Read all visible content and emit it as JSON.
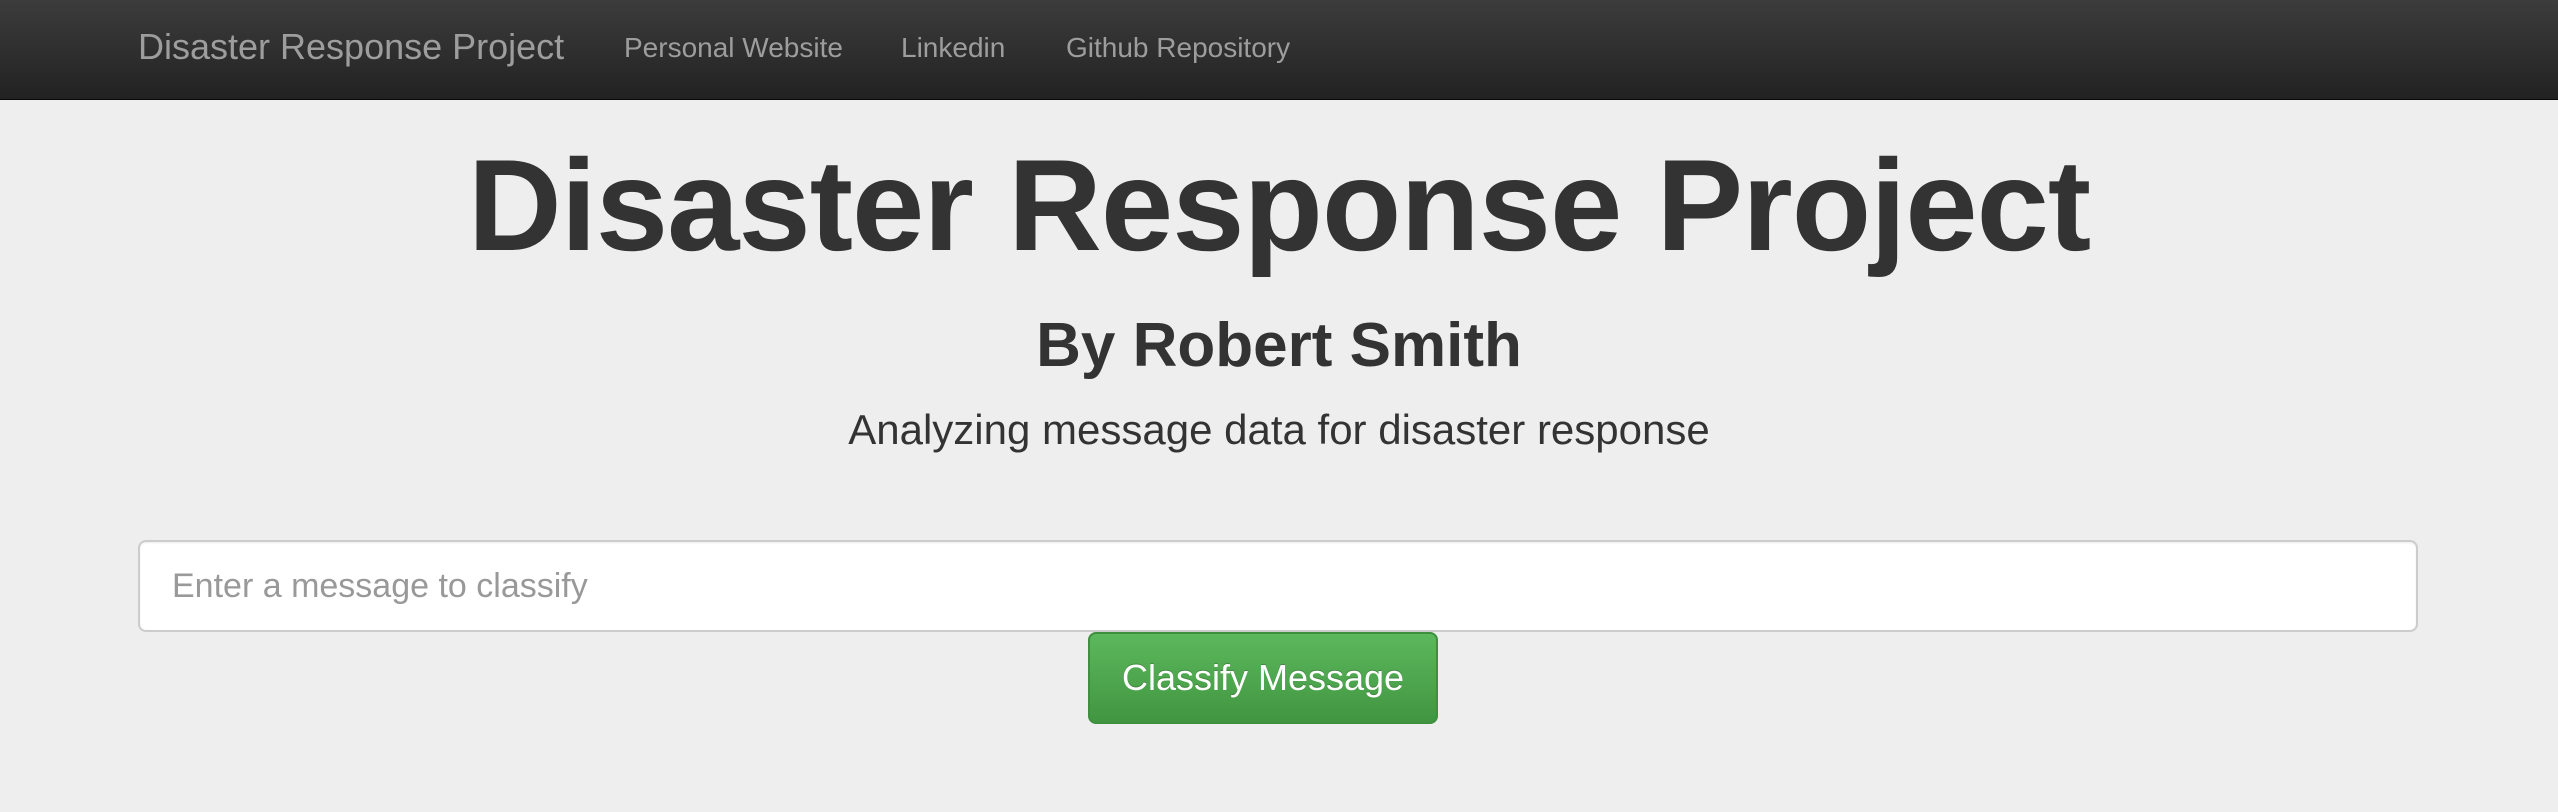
{
  "navbar": {
    "brand": "Disaster Response Project",
    "links": [
      {
        "label": "Personal Website"
      },
      {
        "label": "Linkedin"
      },
      {
        "label": "Github Repository"
      }
    ]
  },
  "jumbotron": {
    "title": "Disaster Response Project",
    "author": "By Robert Smith",
    "subtitle": "Analyzing message data for disaster response"
  },
  "form": {
    "message_placeholder": "Enter a message to classify",
    "message_value": "",
    "submit_label": "Classify Message"
  },
  "colors": {
    "navbar_bg": "#222222",
    "page_bg": "#eeeeee",
    "button_green": "#5cb85c",
    "text_dark": "#333333",
    "nav_text": "#9d9d9d"
  }
}
